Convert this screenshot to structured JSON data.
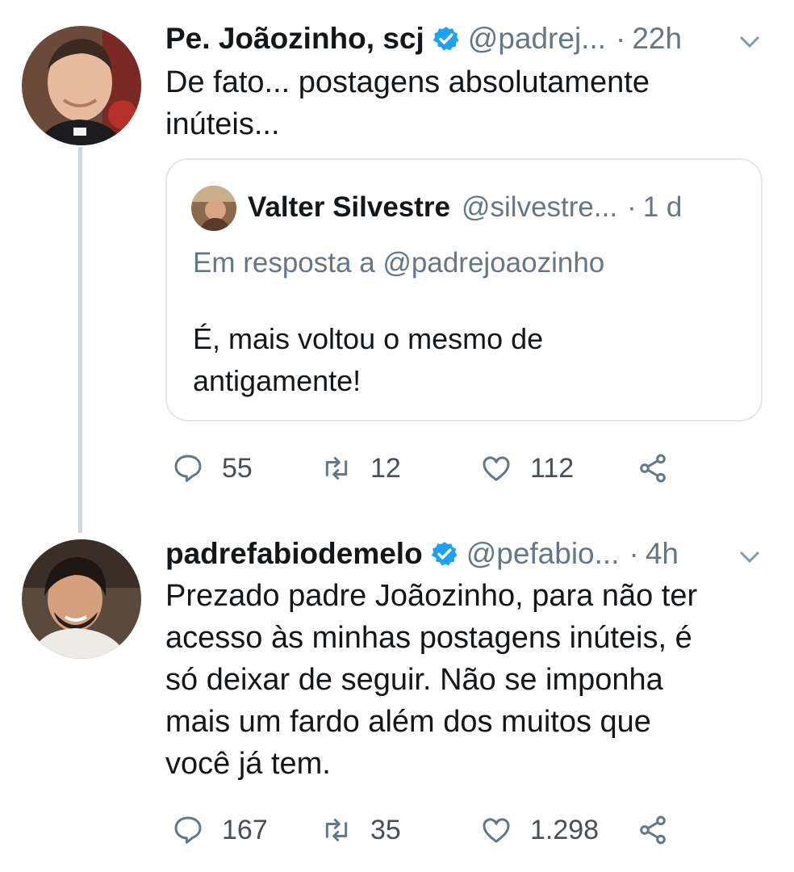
{
  "tweets": [
    {
      "name": "Pe. Joãozinho, scj",
      "handle": "@padrej...",
      "time": "22h",
      "lines": [
        "De fato... postagens absolutamente",
        "inúteis..."
      ],
      "quote": {
        "name": "Valter Silvestre",
        "handle": "@silvestre...",
        "time": "1 d",
        "reply_to": "Em resposta a @padrejoaozinho",
        "lines": [
          "É, mais voltou o mesmo de",
          "antigamente!"
        ]
      },
      "replies": "55",
      "retweets": "12",
      "likes": "112"
    },
    {
      "name": "padrefabiodemelo",
      "handle": "@pefabio...",
      "time": "4h",
      "lines": [
        "Prezado padre Joãozinho, para não ter",
        "acesso às minhas postagens inúteis, é",
        "só deixar de seguir. Não se imponha",
        "mais um fardo além dos muitos que",
        "você já tem."
      ],
      "replies": "167",
      "retweets": "35",
      "likes": "1.298"
    }
  ],
  "separator": "·",
  "icons": {
    "verified": "verified-badge-icon",
    "reply": "reply-icon",
    "retweet": "retweet-icon",
    "like": "heart-icon",
    "share": "share-icon",
    "menu": "chevron-down-icon"
  },
  "colors": {
    "verified": "#1da1f2",
    "secondary_text": "#657786",
    "thread_line": "#cdd8e3",
    "border": "#e1e8ed"
  }
}
